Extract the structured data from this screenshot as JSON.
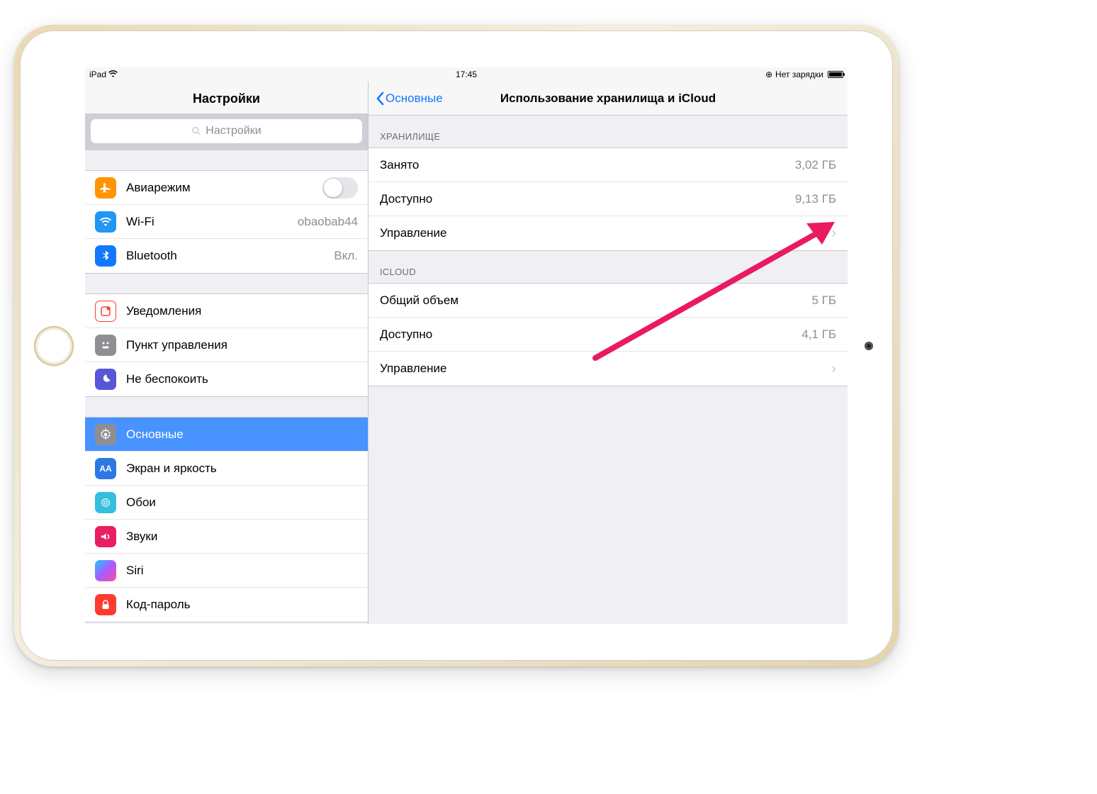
{
  "status": {
    "device": "iPad",
    "time": "17:45",
    "charging_text": "Нет зарядки"
  },
  "sidebar": {
    "title": "Настройки",
    "search_placeholder": "Настройки",
    "g1": {
      "airplane": "Авиарежим",
      "wifi": "Wi-Fi",
      "wifi_value": "obaobab44",
      "bluetooth": "Bluetooth",
      "bluetooth_value": "Вкл."
    },
    "g2": {
      "notifications": "Уведомления",
      "control_center": "Пункт управления",
      "dnd": "Не беспокоить"
    },
    "g3": {
      "general": "Основные",
      "display": "Экран и яркость",
      "wallpaper": "Обои",
      "sounds": "Звуки",
      "siri": "Siri",
      "passcode": "Код-пароль"
    }
  },
  "detail": {
    "back": "Основные",
    "title": "Использование хранилища и iCloud",
    "storage_header": "ХРАНИЛИЩЕ",
    "storage": {
      "used_label": "Занято",
      "used_value": "3,02 ГБ",
      "available_label": "Доступно",
      "available_value": "9,13 ГБ",
      "manage_label": "Управление"
    },
    "icloud_header": "ICLOUD",
    "icloud": {
      "total_label": "Общий объем",
      "total_value": "5 ГБ",
      "available_label": "Доступно",
      "available_value": "4,1 ГБ",
      "manage_label": "Управление"
    }
  }
}
